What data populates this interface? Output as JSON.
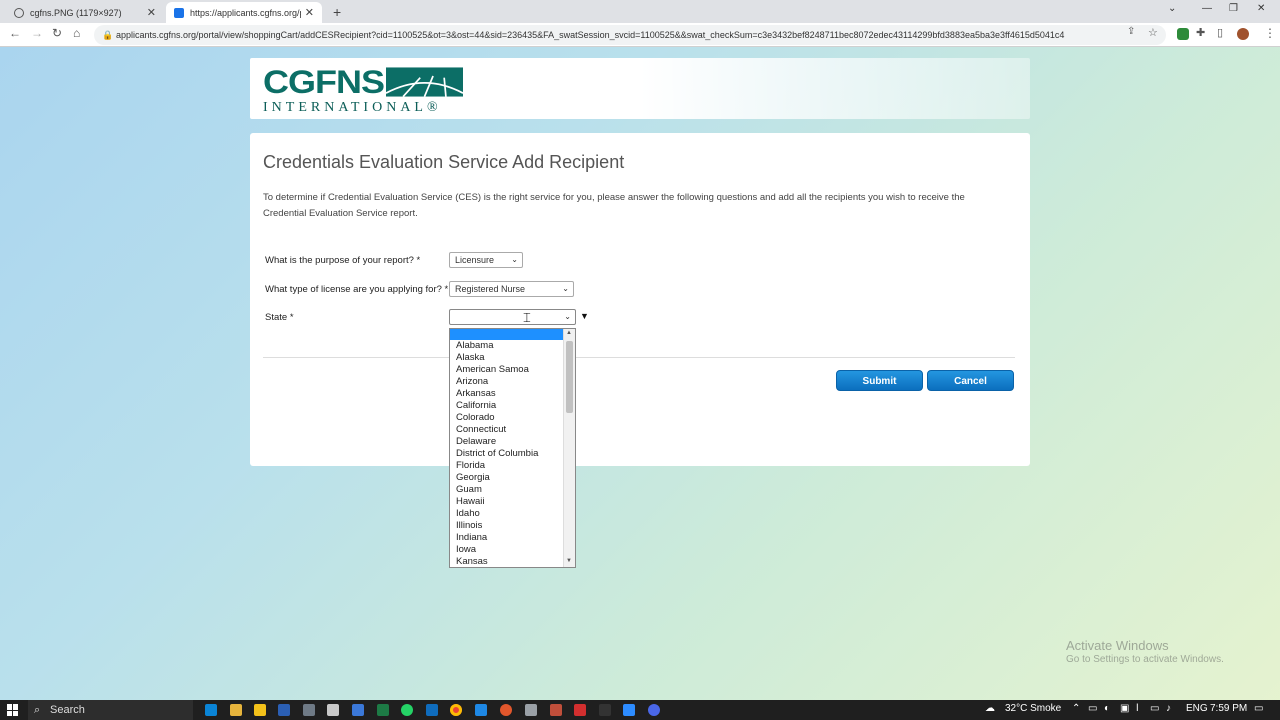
{
  "browser": {
    "tabs": [
      {
        "label": "cgfns.PNG (1179×927)"
      },
      {
        "label": "https://applicants.cgfns.org/port"
      }
    ],
    "url": "applicants.cgfns.org/portal/view/shoppingCart/addCESRecipient?cid=1100525&ot=3&ost=44&sid=236435&FA_swatSession_svcid=1100525&&swat_checkSum=c3e3432bef8248711bec8072edec43114299bfd3883ea5ba3e3ff4615d5041c4"
  },
  "logo": {
    "top": "CGFNS",
    "bottom": "INTERNATIONAL®"
  },
  "page": {
    "title": "Credentials Evaluation Service Add Recipient",
    "intro": "To determine if Credential Evaluation Service (CES) is the right service for you, please answer the following questions and add all the recipients you wish to receive the Credential Evaluation Service report.",
    "q1": {
      "label": "What is the purpose of your report? *",
      "value": "Licensure"
    },
    "q2": {
      "label": "What type of license are you applying for? *",
      "value": "Registered Nurse"
    },
    "q3": {
      "label": "State *",
      "value": ""
    },
    "submit": "Submit",
    "cancel": "Cancel"
  },
  "state_options": [
    "Alabama",
    "Alaska",
    "American Samoa",
    "Arizona",
    "Arkansas",
    "California",
    "Colorado",
    "Connecticut",
    "Delaware",
    "District of Columbia",
    "Florida",
    "Georgia",
    "Guam",
    "Hawaii",
    "Idaho",
    "Illinois",
    "Indiana",
    "Iowa",
    "Kansas"
  ],
  "watermark": {
    "line1": "Activate Windows",
    "line2": "Go to Settings to activate Windows."
  },
  "taskbar": {
    "search": "Search",
    "weather": "32°C  Smoke",
    "lang": "ENG",
    "time": "7:59 PM"
  },
  "colors": {
    "brand": "#0c6e66",
    "button": "#0b6fbe",
    "highlight": "#1e90ff"
  }
}
